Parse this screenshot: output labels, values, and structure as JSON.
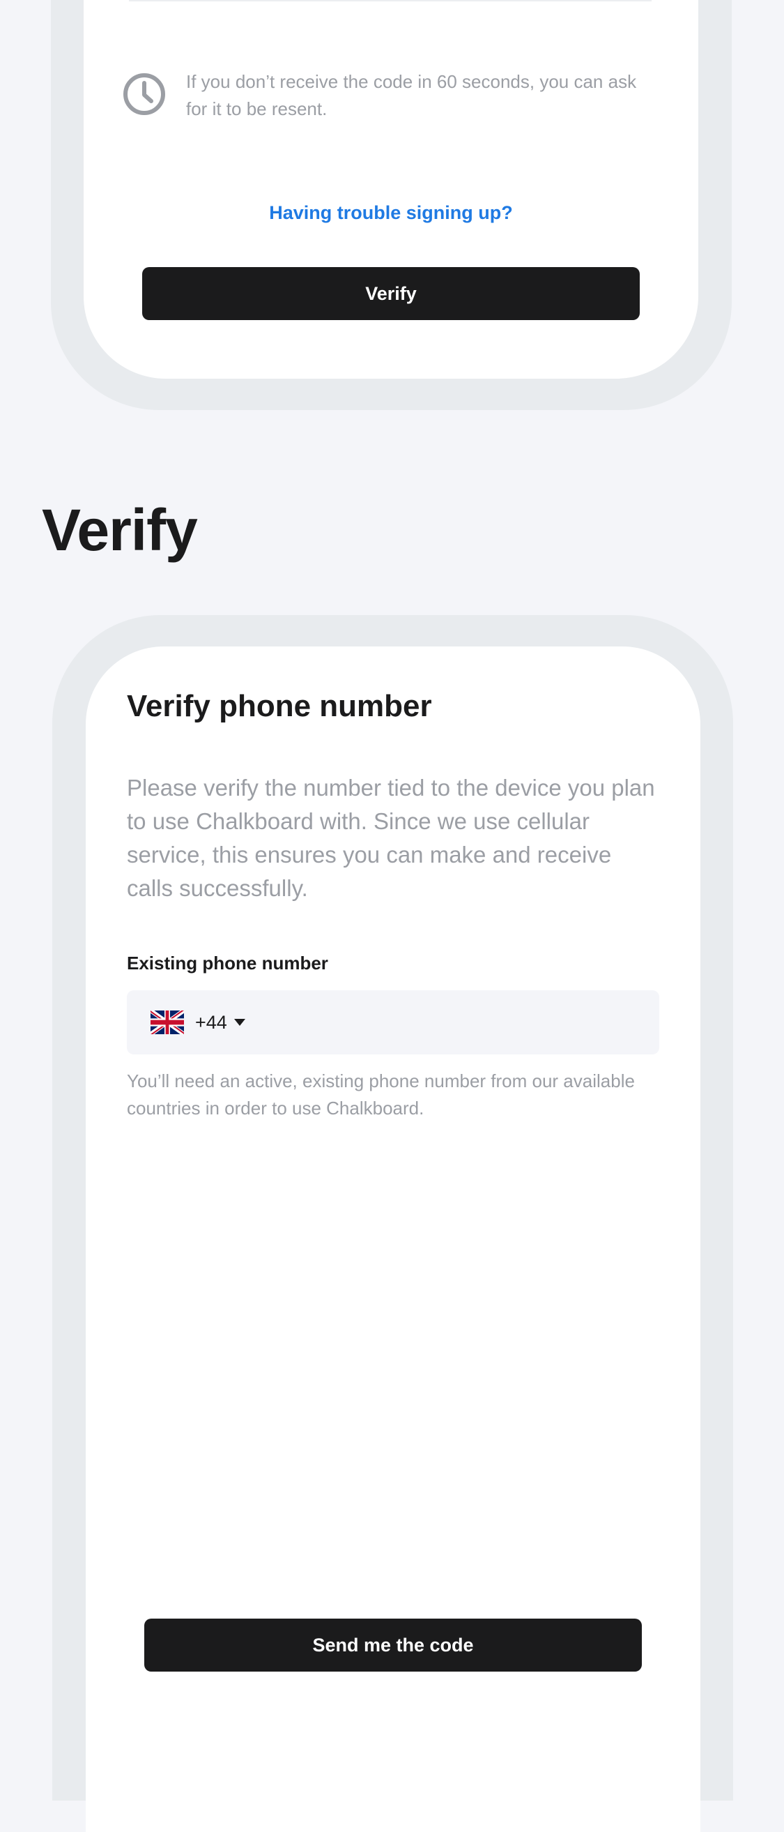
{
  "top_screen": {
    "resend_note": "If you don’t receive the code in 60 seconds, you can ask for it to be resent.",
    "trouble_link": "Having trouble signing up?",
    "verify_button": "Verify",
    "clock_icon": "clock-icon"
  },
  "section": {
    "heading": "Verify"
  },
  "verify_screen": {
    "title": "Verify phone number",
    "description": "Please verify the number tied to the device you plan to use Chalkboard with. Since we use cellular service, this ensures you can make and receive calls successfully.",
    "phone_field": {
      "label": "Existing phone number",
      "country_flag": "uk-flag-icon",
      "dial_code": "+44",
      "dropdown_icon": "caret-down-icon",
      "value": ""
    },
    "helper_text": "You’ll need an active, existing phone number from our available countries in order to use Chalkboard.",
    "send_button": "Send me the code"
  },
  "colors": {
    "background": "#f4f5f9",
    "frame": "#e8ebee",
    "screen": "#ffffff",
    "primary_text": "#1b1b1c",
    "secondary_text": "#9b9ea4",
    "link": "#1f7ae3",
    "button": "#1b1b1c",
    "field_background": "#f4f5f9"
  }
}
